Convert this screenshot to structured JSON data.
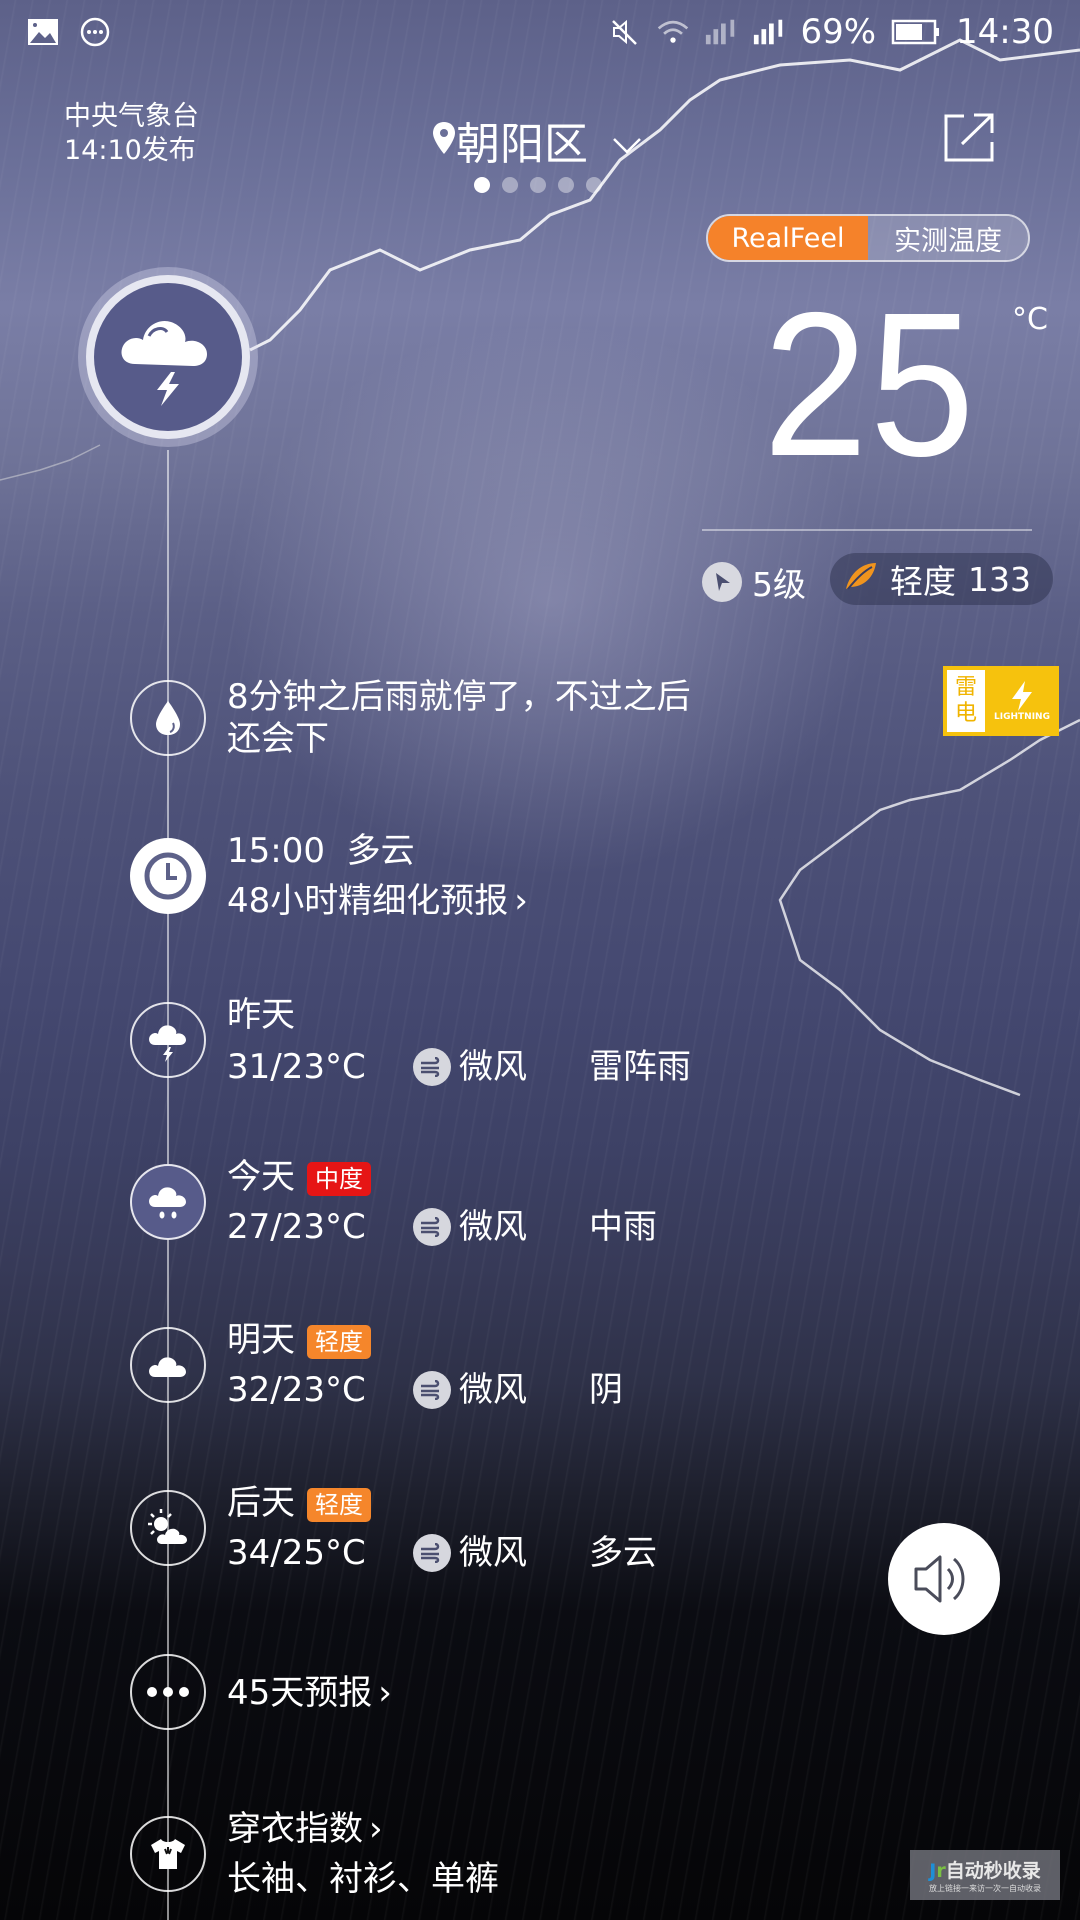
{
  "status_bar": {
    "left_icons": [
      "gallery-icon",
      "more-circle-icon"
    ],
    "right_icons": [
      "mute-icon",
      "wifi-icon",
      "signal-sim1-icon",
      "signal-sim2-icon",
      "battery-icon"
    ],
    "battery": "69%",
    "battery_level": 0.69,
    "time": "14:30"
  },
  "header": {
    "publisher": "中央气象台",
    "publish_time": "14:10发布",
    "location": "朝阳区",
    "page_count": 5,
    "active_page": 1
  },
  "temp_toggle": {
    "options": [
      "RealFeel",
      "实测温度"
    ],
    "selected": "RealFeel",
    "accent": "#f5822a"
  },
  "current": {
    "temperature": "25",
    "unit": "°C",
    "condition_icon": "thunderstorm-icon",
    "wind": "5级",
    "aqi_label": "轻度",
    "aqi_value": "133"
  },
  "alert": {
    "title_line1": "雷",
    "title_line2": "电",
    "label": "LIGHTNING",
    "color": "#f6c20d"
  },
  "timeline": {
    "nowcast": "8分钟之后雨就停了，不过之后",
    "nowcast_line2": "还会下",
    "hourly_time": "15:00",
    "hourly_condition": "多云",
    "hourly_link": "48小时精细化预报",
    "days": [
      {
        "label": "昨天",
        "badge": "",
        "temps": "31/23°C",
        "wind": "微风",
        "condition": "雷阵雨",
        "icon": "thunder-cloud-icon"
      },
      {
        "label": "今天",
        "badge": "中度",
        "badge_color": "#e61515",
        "temps": "27/23°C",
        "wind": "微风",
        "condition": "中雨",
        "icon": "rain-cloud-icon"
      },
      {
        "label": "明天",
        "badge": "轻度",
        "badge_color": "#f5862b",
        "temps": "32/23°C",
        "wind": "微风",
        "condition": "阴",
        "icon": "cloud-icon"
      },
      {
        "label": "后天",
        "badge": "轻度",
        "badge_color": "#f5862b",
        "temps": "34/25°C",
        "wind": "微风",
        "condition": "多云",
        "icon": "partly-cloudy-icon"
      }
    ],
    "long_forecast": "45天预报",
    "clothing_title": "穿衣指数",
    "clothing_value": "长袖、衬衫、单裤"
  },
  "watermark": {
    "logo_j": "J",
    "logo_r": "r",
    "title": "自动秒收录",
    "subtitle": "放上链接一来访一次一自动收录"
  }
}
